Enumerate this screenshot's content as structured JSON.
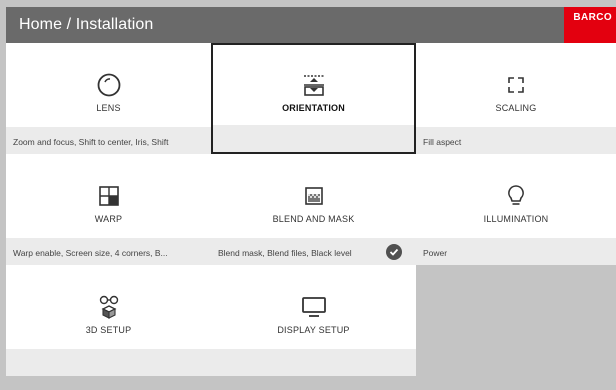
{
  "header": {
    "title": "Home / Installation",
    "logo_text": "BARCO",
    "logo_color": "#e3000f",
    "bar_color": "#6a6a6a"
  },
  "tiles": [
    {
      "label": "LENS",
      "description": "Zoom and focus, Shift to center, Iris, Shift",
      "icon": "lens-icon",
      "selected": false,
      "checked": false
    },
    {
      "label": "ORIENTATION",
      "description": "",
      "icon": "orientation-icon",
      "selected": true,
      "checked": false
    },
    {
      "label": "SCALING",
      "description": "Fill aspect",
      "icon": "scaling-icon",
      "selected": false,
      "checked": false
    },
    {
      "label": "WARP",
      "description": "Warp enable, Screen size, 4 corners, B...",
      "icon": "warp-icon",
      "selected": false,
      "checked": false
    },
    {
      "label": "BLEND AND MASK",
      "description": "Blend mask, Blend files, Black level",
      "icon": "blend-mask-icon",
      "selected": false,
      "checked": true
    },
    {
      "label": "ILLUMINATION",
      "description": "Power",
      "icon": "lightbulb-icon",
      "selected": false,
      "checked": false
    },
    {
      "label": "3D SETUP",
      "description": "",
      "icon": "3d-glasses-icon",
      "selected": false,
      "checked": false
    },
    {
      "label": "DISPLAY SETUP",
      "description": "",
      "icon": "monitor-icon",
      "selected": false,
      "checked": false
    }
  ]
}
